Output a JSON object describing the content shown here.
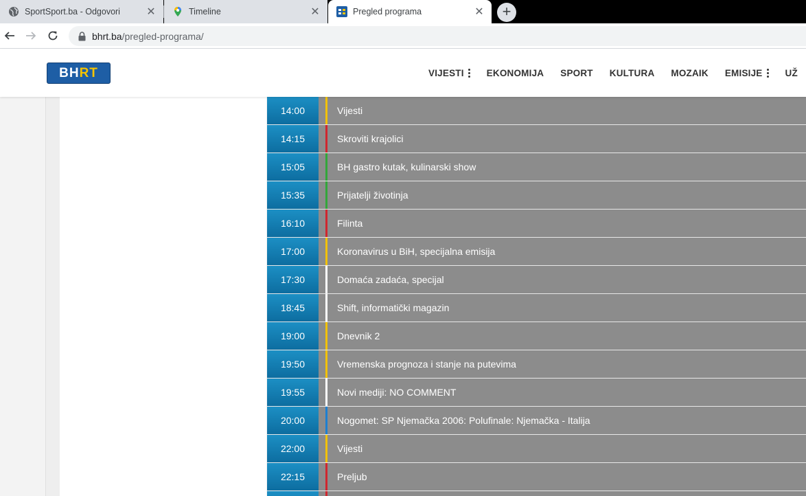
{
  "browser": {
    "tabs": [
      {
        "title": "SportSport.ba - Odgovori",
        "active": false,
        "icon": "globe-icon"
      },
      {
        "title": "Timeline",
        "active": false,
        "icon": "map-pin-icon"
      },
      {
        "title": "Pregled programa",
        "active": true,
        "icon": "bhrt-favicon"
      }
    ],
    "close_glyph": "✕",
    "new_tab_glyph": "+",
    "url_host": "bhrt.ba",
    "url_path": "/pregled-programa/"
  },
  "site": {
    "logo_bh": "BH",
    "logo_rt": "RT",
    "nav": [
      {
        "label": "VIJESTI",
        "has_menu": true
      },
      {
        "label": "EKONOMIJA",
        "has_menu": false
      },
      {
        "label": "SPORT",
        "has_menu": false
      },
      {
        "label": "KULTURA",
        "has_menu": false
      },
      {
        "label": "MOZAIK",
        "has_menu": false
      },
      {
        "label": "EMISIJE",
        "has_menu": true
      },
      {
        "label": "UŽ",
        "has_menu": false
      }
    ]
  },
  "colors": {
    "yellow": "#f2c200",
    "red": "#d0262e",
    "green": "#33a63a",
    "white": "#ffffff",
    "blue": "#1d7fd1"
  },
  "schedule": [
    {
      "time": "14:00",
      "title": "Vijesti",
      "category": "yellow"
    },
    {
      "time": "14:15",
      "title": "Skroviti krajolici",
      "category": "red"
    },
    {
      "time": "15:05",
      "title": "BH gastro kutak, kulinarski show",
      "category": "green"
    },
    {
      "time": "15:35",
      "title": "Prijatelji životinja",
      "category": "green"
    },
    {
      "time": "16:10",
      "title": "Filinta",
      "category": "red"
    },
    {
      "time": "17:00",
      "title": "Koronavirus u BiH, specijalna emisija",
      "category": "yellow"
    },
    {
      "time": "17:30",
      "title": "Domaća zadaća, specijal",
      "category": "white"
    },
    {
      "time": "18:45",
      "title": "Shift, informatički magazin",
      "category": "white"
    },
    {
      "time": "19:00",
      "title": "Dnevnik 2",
      "category": "yellow"
    },
    {
      "time": "19:50",
      "title": "Vremenska prognoza i stanje na putevima",
      "category": "yellow"
    },
    {
      "time": "19:55",
      "title": "Novi mediji: NO COMMENT",
      "category": "white"
    },
    {
      "time": "20:00",
      "title": "Nogomet: SP Njemačka 2006: Polufinale: Njemačka - Italija",
      "category": "blue"
    },
    {
      "time": "22:00",
      "title": "Vijesti",
      "category": "yellow"
    },
    {
      "time": "22:15",
      "title": "Preljub",
      "category": "red"
    },
    {
      "time": "",
      "title": "",
      "category": "red"
    }
  ]
}
